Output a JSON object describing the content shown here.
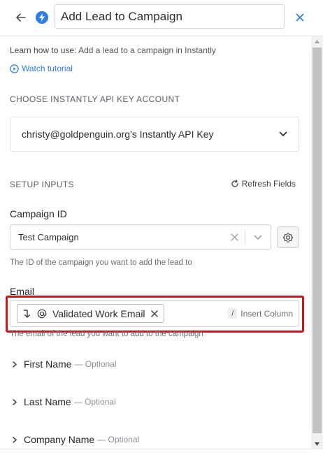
{
  "header": {
    "title": "Add Lead to Campaign",
    "back_icon": "arrow-left-icon",
    "app_icon": "instantly-bolt-icon",
    "close_icon": "close-icon",
    "accent": "#2f7de1"
  },
  "learn": {
    "prefix": "Learn how to use:",
    "description": "Add a lead to a campaign in Instantly",
    "tutorial_label": "Watch tutorial"
  },
  "account_section": {
    "title": "CHOOSE INSTANTLY API KEY ACCOUNT",
    "selected_account": "christy@goldpenguin.org's Instantly API Key"
  },
  "setup_section": {
    "title": "SETUP INPUTS",
    "refresh_label": "Refresh Fields"
  },
  "campaign_field": {
    "label": "Campaign ID",
    "value": "Test Campaign",
    "help": "The ID of the campaign you want to add the lead to"
  },
  "email_field": {
    "label": "Email",
    "chip_label": "Validated Work Email",
    "insert_key": "/",
    "insert_label": "Insert Column",
    "help": "The email of the lead you want to add to the campaign",
    "highlight_color": "#c8171e"
  },
  "optional_fields": [
    {
      "name": "First Name",
      "optional_label": "— Optional"
    },
    {
      "name": "Last Name",
      "optional_label": "— Optional"
    },
    {
      "name": "Company Name",
      "optional_label": "— Optional"
    }
  ]
}
